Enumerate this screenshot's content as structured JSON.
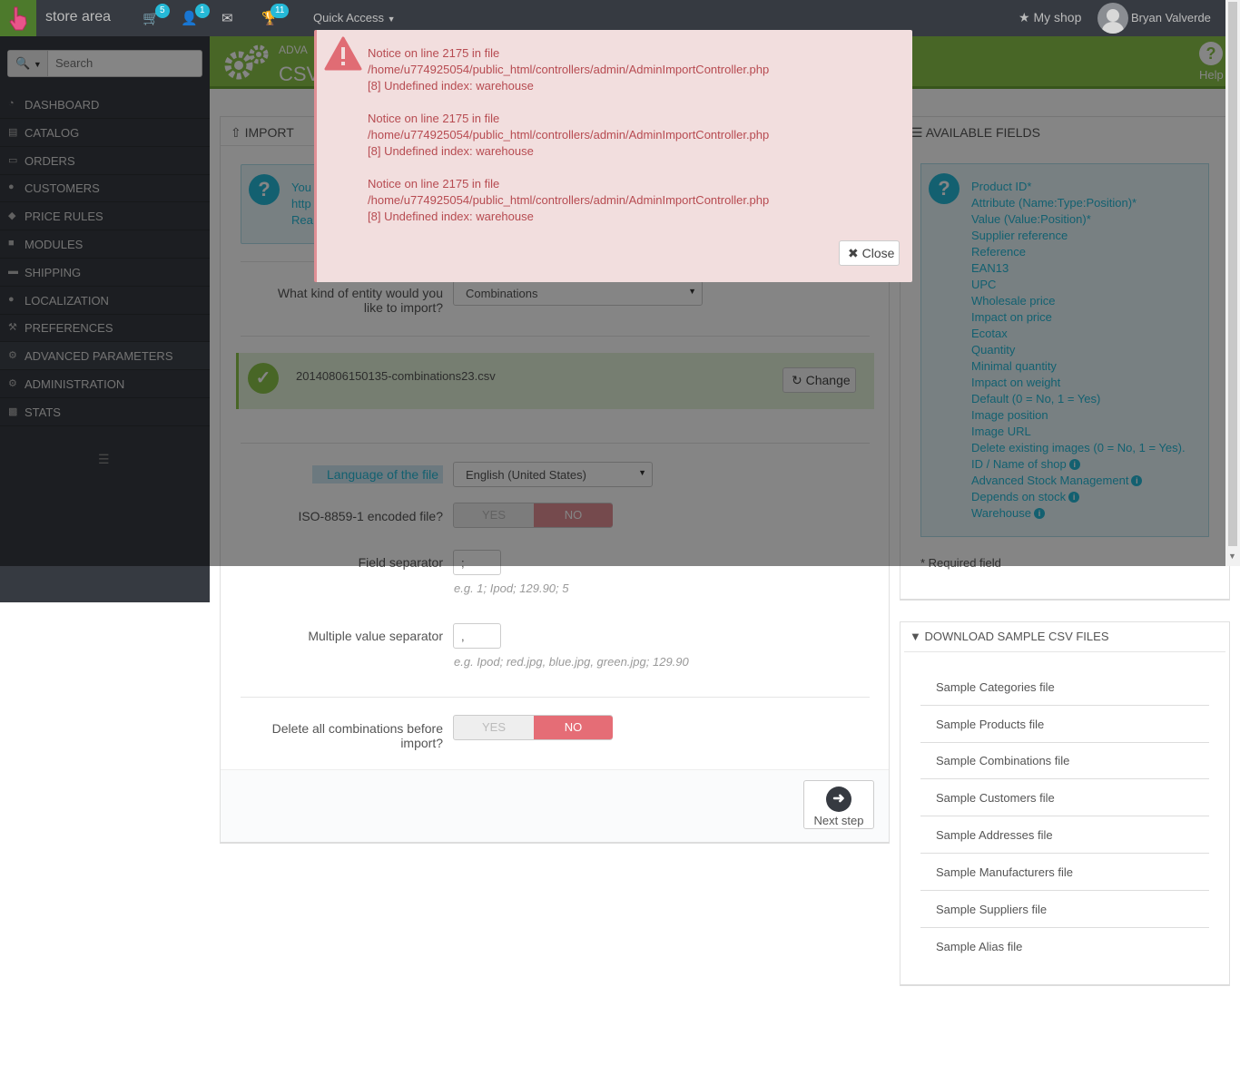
{
  "topbar": {
    "brand": "store area",
    "badges": {
      "orders": "5",
      "customers": "1",
      "messages_icon": "envelope-icon",
      "trophy": "11"
    },
    "quick_access": "Quick Access",
    "my_shop": "My shop",
    "user_name": "Bryan Valverde"
  },
  "sidebar": {
    "search_placeholder": "Search",
    "items": [
      {
        "label": "DASHBOARD",
        "icon": "dashboard-icon"
      },
      {
        "label": "CATALOG",
        "icon": "book-icon"
      },
      {
        "label": "ORDERS",
        "icon": "credit-card-icon"
      },
      {
        "label": "CUSTOMERS",
        "icon": "users-icon"
      },
      {
        "label": "PRICE RULES",
        "icon": "tags-icon"
      },
      {
        "label": "MODULES",
        "icon": "puzzle-icon"
      },
      {
        "label": "SHIPPING",
        "icon": "truck-icon"
      },
      {
        "label": "LOCALIZATION",
        "icon": "globe-icon"
      },
      {
        "label": "PREFERENCES",
        "icon": "wrench-icon"
      },
      {
        "label": "ADVANCED PARAMETERS",
        "icon": "cogs-icon"
      },
      {
        "label": "ADMINISTRATION",
        "icon": "cog-icon"
      },
      {
        "label": "STATS",
        "icon": "bar-chart-icon"
      }
    ]
  },
  "header": {
    "breadcrumb": "ADVA",
    "title": "CSV",
    "help": "Help"
  },
  "import_panel": {
    "title": "IMPORT",
    "info_lines": [
      "You",
      "http",
      "Rea"
    ],
    "entity_label_1": "What kind of entity would you",
    "entity_label_2": "like to import?",
    "entity_value": "Combinations",
    "file_name": "20140806150135-combinations23.csv",
    "change": "Change",
    "language_label": "Language of the file",
    "language_value": "English (United States)",
    "iso_label": "ISO-8859-1 encoded file?",
    "yes": "YES",
    "no": "NO",
    "field_sep_label": "Field separator",
    "field_sep_value": ";",
    "field_sep_help": "e.g. 1; Ipod; 129.90; 5",
    "multi_sep_label": "Multiple value separator",
    "multi_sep_value": ",",
    "multi_sep_help": "e.g. Ipod; red.jpg, blue.jpg, green.jpg; 129.90",
    "delete_label_1": "Delete all combinations before",
    "delete_label_2": "import?",
    "next_step": "Next step"
  },
  "available_fields": {
    "title": "AVAILABLE FIELDS",
    "fields": [
      "Product ID*",
      "Attribute (Name:Type:Position)*",
      "Value (Value:Position)*",
      "Supplier reference",
      "Reference",
      "EAN13",
      "UPC",
      "Wholesale price",
      "Impact on price",
      "Ecotax",
      "Quantity",
      "Minimal quantity",
      "Impact on weight",
      "Default (0 = No, 1 = Yes)",
      "Image position",
      "Image URL",
      "Delete existing images (0 = No, 1 = Yes).",
      "ID / Name of shop",
      "Advanced Stock Management",
      "Depends on stock",
      "Warehouse"
    ],
    "required_note": "* Required field"
  },
  "samples": {
    "title": "DOWNLOAD SAMPLE CSV FILES",
    "files": [
      "Sample Categories file",
      "Sample Products file",
      "Sample Combinations file",
      "Sample Customers file",
      "Sample Addresses file",
      "Sample Manufacturers file",
      "Sample Suppliers file",
      "Sample Alias file"
    ]
  },
  "modal": {
    "lines": [
      "Notice on line 2175 in file",
      "/home/u774925054/public_html/controllers/admin/AdminImportController.php",
      "[8] Undefined index: warehouse",
      "Notice on line 2175 in file",
      "/home/u774925054/public_html/controllers/admin/AdminImportController.php",
      "[8] Undefined index: warehouse",
      "Notice on line 2175 in file",
      "/home/u774925054/public_html/controllers/admin/AdminImportController.php",
      "[8] Undefined index: warehouse"
    ],
    "close": "Close"
  },
  "colors": {
    "accent": "#25b9d7",
    "header_green": "#8bc34a",
    "danger": "#e08f95",
    "dark": "#363a41"
  }
}
